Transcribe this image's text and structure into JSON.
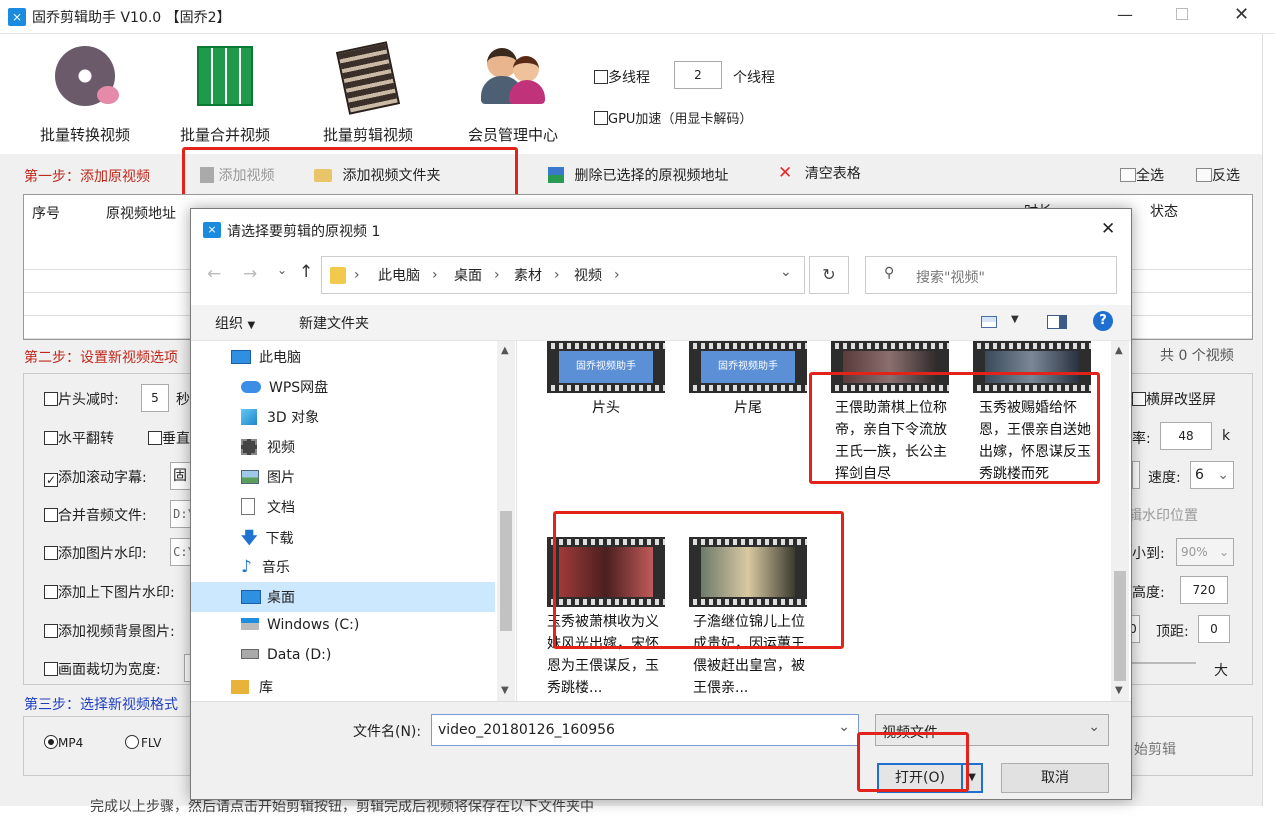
{
  "app": {
    "title": "固乔剪辑助手 V10.0 【固乔2】"
  },
  "toolbar": {
    "items": [
      "批量转换视频",
      "批量合并视频",
      "批量剪辑视频",
      "会员管理中心"
    ]
  },
  "options": {
    "multithread_label": "多线程",
    "thread_count": "2",
    "thread_unit": "个线程",
    "gpu_label": "GPU加速（用显卡解码）"
  },
  "step1": {
    "label": "第一步：添加原视频",
    "add_video": "添加视频",
    "add_folder": "添加视频文件夹",
    "delete_selected": "删除已选择的原视频地址",
    "clear_table": "清空表格",
    "select_all": "全选",
    "invert_select": "反选"
  },
  "table": {
    "columns": [
      "序号",
      "原视频地址",
      "时长",
      "状态"
    ]
  },
  "count_label": "共 0 个视频",
  "step2": {
    "label": "第二步：设置新视频选项",
    "head_cut": "片头减时:",
    "head_cut_value": "5",
    "head_cut_unit": "秒",
    "hflip": "水平翻转",
    "vflip": "垂直",
    "scroll_text": "添加滚动字幕:",
    "scroll_text_value": "固",
    "merge_audio": "合并音频文件:",
    "merge_audio_value": "D:\\",
    "image_wm": "添加图片水印:",
    "image_wm_value": "C:\\",
    "topbottom_wm": "添加上下图片水印:",
    "bg_image": "添加视频背景图片:",
    "crop": "画面裁切为宽度:",
    "landscape": "横屏改竖屏",
    "rate_label": "率:",
    "rate_value": "48",
    "rate_unit": "k",
    "speed_label": "速度:",
    "speed_value": "6",
    "edit_wm_pos": "辑水印位置",
    "shrink_label": "小到:",
    "shrink_value": "90%",
    "height_label": "高度:",
    "height_value": "720",
    "top_label": "顶距:",
    "top_value": "0",
    "left_value": "0",
    "big_label": "大"
  },
  "step3": {
    "label": "第三步：选择新视频格式",
    "formats": [
      "MP4",
      "FLV"
    ],
    "start_label": "始剪辑"
  },
  "bottom_text": "完成以上步骤，然后请点击开始剪辑按钮，剪辑完成后视频将保存在以下文件夹中",
  "dialog": {
    "title": "请选择要剪辑的原视频 1",
    "breadcrumb": [
      "此电脑",
      "桌面",
      "素材",
      "视频"
    ],
    "search_placeholder": "搜索\"视频\"",
    "organize": "组织",
    "new_folder": "新建文件夹",
    "nav": [
      "此电脑",
      "WPS网盘",
      "3D 对象",
      "视频",
      "图片",
      "文档",
      "下载",
      "音乐",
      "桌面",
      "Windows (C:)",
      "Data (D:)",
      "库"
    ],
    "files": [
      {
        "name": "片头",
        "thumb_text": "固乔视频助手"
      },
      {
        "name": "片尾",
        "thumb_text": "固乔视频助手"
      },
      {
        "name": "王偎助萧棋上位称帝，亲自下令流放王氏一族，长公主挥剑自尽"
      },
      {
        "name": "玉秀被赐婚给怀恩，王偎亲自送她出嫁，怀恩谋反玉秀跳楼而死"
      },
      {
        "name": "玉秀被萧棋收为义妹风光出嫁，宋怀恩为王偎谋反，玉秀跳楼..."
      },
      {
        "name": "子澹继位锦儿上位成贵妃，因运蕙王偎被赶出皇宫，被王偎亲..."
      }
    ],
    "filename_label": "文件名(N):",
    "filename_value": "video_20180126_160956",
    "filetype": "视频文件",
    "open": "打开(O)",
    "cancel": "取消"
  },
  "colors": {
    "step_red": "#c0281c",
    "step_blue": "#1f3fbf",
    "highlight": "#e2231a",
    "select_bg": "#cce8ff"
  }
}
